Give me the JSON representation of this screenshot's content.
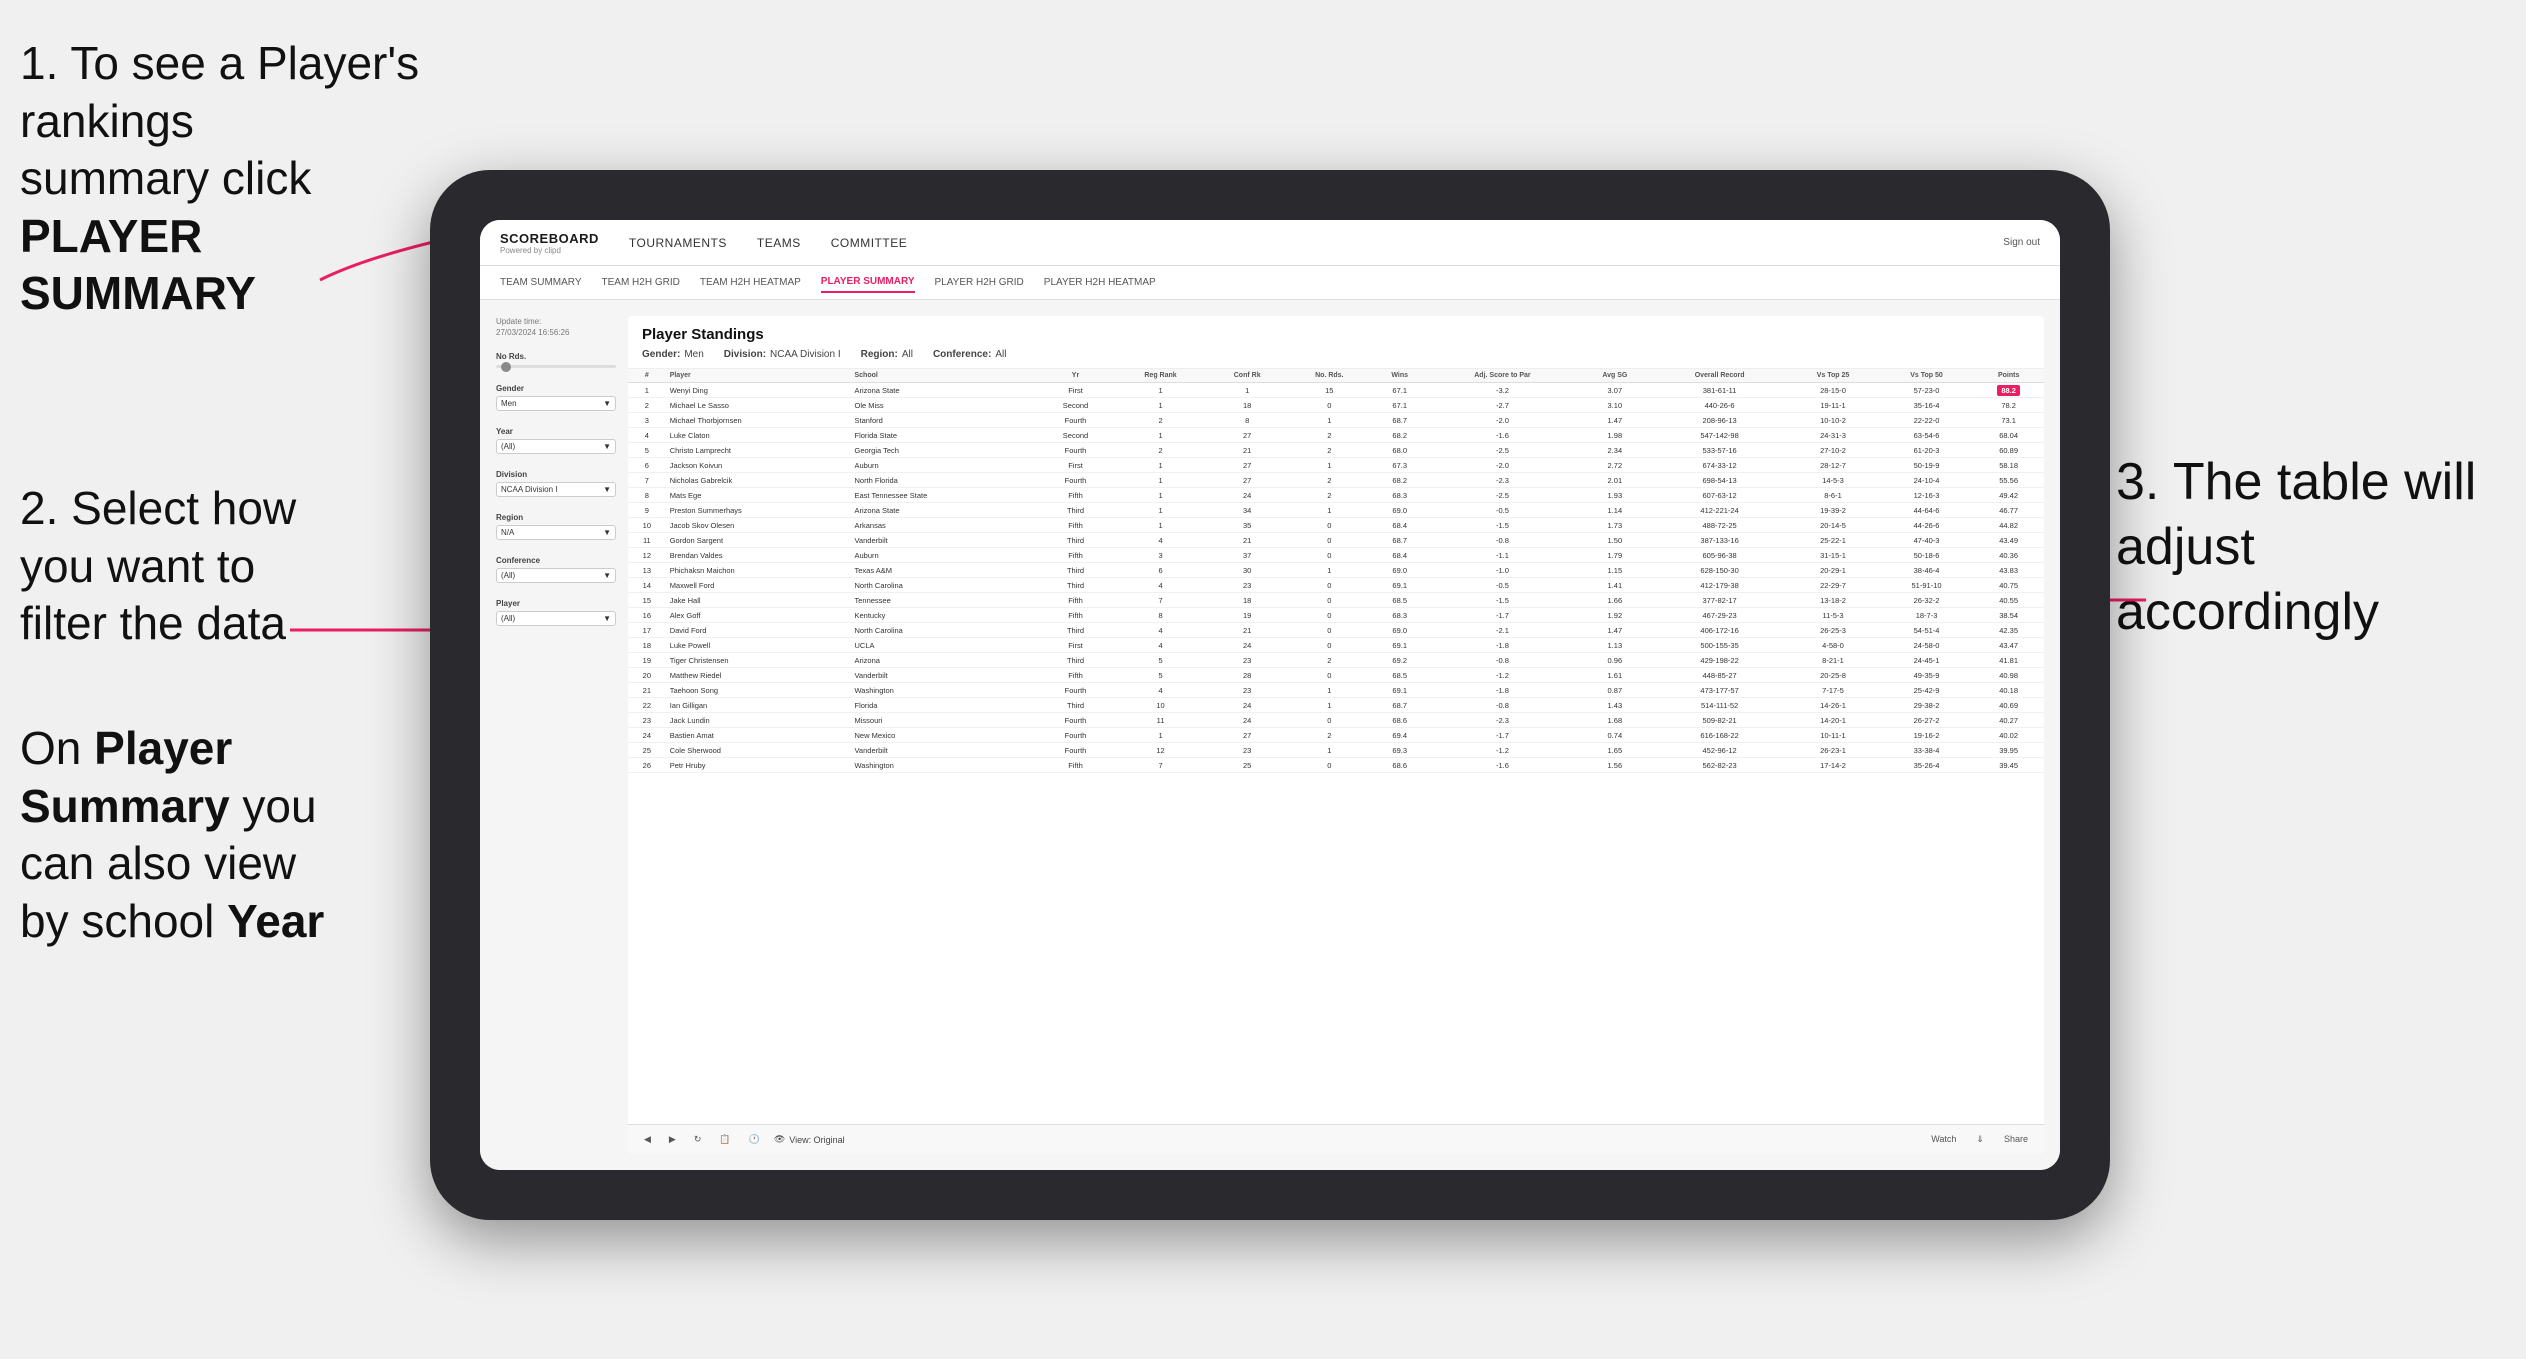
{
  "instructions": {
    "step1_line1": "1. To see a Player's rankings",
    "step1_line2": "summary click ",
    "step1_bold": "PLAYER SUMMARY",
    "step2_line1": "2. Select how",
    "step2_line2": "you want to",
    "step2_line3": "filter the data",
    "step_bottom_line1": "On ",
    "step_bottom_bold1": "Player",
    "step_bottom_line2": "Summary",
    "step_bottom_line3": " you",
    "step_bottom_line4": "can also view",
    "step_bottom_line5": "by school ",
    "step_bottom_bold2": "Year",
    "step3_line1": "3. The table will",
    "step3_line2": "adjust accordingly"
  },
  "nav": {
    "logo": "SCOREBOARD",
    "logo_sub": "Powered by clipd",
    "items": [
      "TOURNAMENTS",
      "TEAMS",
      "COMMITTEE"
    ],
    "sign_out": "Sign out"
  },
  "sub_nav": {
    "items": [
      "TEAM SUMMARY",
      "TEAM H2H GRID",
      "TEAM H2H HEATMAP",
      "PLAYER SUMMARY",
      "PLAYER H2H GRID",
      "PLAYER H2H HEATMAP"
    ]
  },
  "filters": {
    "update_label": "Update time:",
    "update_value": "27/03/2024 16:56:26",
    "no_rds_label": "No Rds.",
    "gender_label": "Gender",
    "gender_value": "Men",
    "year_label": "Year",
    "year_value": "(All)",
    "division_label": "Division",
    "division_value": "NCAA Division I",
    "region_label": "Region",
    "region_value": "N/A",
    "conference_label": "Conference",
    "conference_value": "(All)",
    "player_label": "Player",
    "player_value": "(All)"
  },
  "table": {
    "title": "Player Standings",
    "gender_label": "Gender:",
    "gender_value": "Men",
    "division_label": "Division:",
    "division_value": "NCAA Division I",
    "region_label": "Region:",
    "region_value": "All",
    "conference_label": "Conference:",
    "conference_value": "All",
    "columns": [
      "#",
      "Player",
      "School",
      "Yr",
      "Reg Rank",
      "Conf Rk",
      "No. Rds.",
      "Wins",
      "Adj. Score to Par",
      "Avg SG",
      "Overall Record",
      "Vs Top 25",
      "Vs Top 50",
      "Points"
    ],
    "rows": [
      [
        "1",
        "Wenyi Ding",
        "Arizona State",
        "First",
        "1",
        "1",
        "15",
        "67.1",
        "-3.2",
        "3.07",
        "381-61-11",
        "28-15-0",
        "57-23-0",
        "88.2"
      ],
      [
        "2",
        "Michael Le Sasso",
        "Ole Miss",
        "Second",
        "1",
        "18",
        "0",
        "67.1",
        "-2.7",
        "3.10",
        "440-26-6",
        "19-11-1",
        "35-16-4",
        "78.2"
      ],
      [
        "3",
        "Michael Thorbjornsen",
        "Stanford",
        "Fourth",
        "2",
        "8",
        "1",
        "68.7",
        "-2.0",
        "1.47",
        "208-96-13",
        "10-10-2",
        "22-22-0",
        "73.1"
      ],
      [
        "4",
        "Luke Claton",
        "Florida State",
        "Second",
        "1",
        "27",
        "2",
        "68.2",
        "-1.6",
        "1.98",
        "547-142-98",
        "24-31-3",
        "63-54-6",
        "68.04"
      ],
      [
        "5",
        "Christo Lamprecht",
        "Georgia Tech",
        "Fourth",
        "2",
        "21",
        "2",
        "68.0",
        "-2.5",
        "2.34",
        "533-57-16",
        "27-10-2",
        "61-20-3",
        "60.89"
      ],
      [
        "6",
        "Jackson Koivun",
        "Auburn",
        "First",
        "1",
        "27",
        "1",
        "67.3",
        "-2.0",
        "2.72",
        "674-33-12",
        "28-12-7",
        "50-19-9",
        "58.18"
      ],
      [
        "7",
        "Nicholas Gabrelcik",
        "North Florida",
        "Fourth",
        "1",
        "27",
        "2",
        "68.2",
        "-2.3",
        "2.01",
        "698-54-13",
        "14-5-3",
        "24-10-4",
        "55.56"
      ],
      [
        "8",
        "Mats Ege",
        "East Tennessee State",
        "Fifth",
        "1",
        "24",
        "2",
        "68.3",
        "-2.5",
        "1.93",
        "607-63-12",
        "8-6-1",
        "12-16-3",
        "49.42"
      ],
      [
        "9",
        "Preston Summerhays",
        "Arizona State",
        "Third",
        "1",
        "34",
        "1",
        "69.0",
        "-0.5",
        "1.14",
        "412-221-24",
        "19-39-2",
        "44-64-6",
        "46.77"
      ],
      [
        "10",
        "Jacob Skov Olesen",
        "Arkansas",
        "Fifth",
        "1",
        "35",
        "0",
        "68.4",
        "-1.5",
        "1.73",
        "488-72-25",
        "20-14-5",
        "44-26-6",
        "44.82"
      ],
      [
        "11",
        "Gordon Sargent",
        "Vanderbilt",
        "Third",
        "4",
        "21",
        "0",
        "68.7",
        "-0.8",
        "1.50",
        "387-133-16",
        "25-22-1",
        "47-40-3",
        "43.49"
      ],
      [
        "12",
        "Brendan Valdes",
        "Auburn",
        "Fifth",
        "3",
        "37",
        "0",
        "68.4",
        "-1.1",
        "1.79",
        "605-96-38",
        "31-15-1",
        "50-18-6",
        "40.36"
      ],
      [
        "13",
        "Phichaksn Maichon",
        "Texas A&M",
        "Third",
        "6",
        "30",
        "1",
        "69.0",
        "-1.0",
        "1.15",
        "628-150-30",
        "20-29-1",
        "38-46-4",
        "43.83"
      ],
      [
        "14",
        "Maxwell Ford",
        "North Carolina",
        "Third",
        "4",
        "23",
        "0",
        "69.1",
        "-0.5",
        "1.41",
        "412-179-38",
        "22-29-7",
        "51-91-10",
        "40.75"
      ],
      [
        "15",
        "Jake Hall",
        "Tennessee",
        "Fifth",
        "7",
        "18",
        "0",
        "68.5",
        "-1.5",
        "1.66",
        "377-82-17",
        "13-18-2",
        "26-32-2",
        "40.55"
      ],
      [
        "16",
        "Alex Goff",
        "Kentucky",
        "Fifth",
        "8",
        "19",
        "0",
        "68.3",
        "-1.7",
        "1.92",
        "467-29-23",
        "11-5-3",
        "18-7-3",
        "38.54"
      ],
      [
        "17",
        "David Ford",
        "North Carolina",
        "Third",
        "4",
        "21",
        "0",
        "69.0",
        "-2.1",
        "1.47",
        "406-172-16",
        "26-25-3",
        "54-51-4",
        "42.35"
      ],
      [
        "18",
        "Luke Powell",
        "UCLA",
        "First",
        "4",
        "24",
        "0",
        "69.1",
        "-1.8",
        "1.13",
        "500-155-35",
        "4-58-0",
        "24-58-0",
        "43.47"
      ],
      [
        "19",
        "Tiger Christensen",
        "Arizona",
        "Third",
        "5",
        "23",
        "2",
        "69.2",
        "-0.8",
        "0.96",
        "429-198-22",
        "8-21-1",
        "24-45-1",
        "41.81"
      ],
      [
        "20",
        "Matthew Riedel",
        "Vanderbilt",
        "Fifth",
        "5",
        "28",
        "0",
        "68.5",
        "-1.2",
        "1.61",
        "448-85-27",
        "20-25-8",
        "49-35-9",
        "40.98"
      ],
      [
        "21",
        "Taehoon Song",
        "Washington",
        "Fourth",
        "4",
        "23",
        "1",
        "69.1",
        "-1.8",
        "0.87",
        "473-177-57",
        "7-17-5",
        "25-42-9",
        "40.18"
      ],
      [
        "22",
        "Ian Gilligan",
        "Florida",
        "Third",
        "10",
        "24",
        "1",
        "68.7",
        "-0.8",
        "1.43",
        "514-111-52",
        "14-26-1",
        "29-38-2",
        "40.69"
      ],
      [
        "23",
        "Jack Lundin",
        "Missouri",
        "Fourth",
        "11",
        "24",
        "0",
        "68.6",
        "-2.3",
        "1.68",
        "509-82-21",
        "14-20-1",
        "26-27-2",
        "40.27"
      ],
      [
        "24",
        "Bastien Amat",
        "New Mexico",
        "Fourth",
        "1",
        "27",
        "2",
        "69.4",
        "-1.7",
        "0.74",
        "616-168-22",
        "10-11-1",
        "19-16-2",
        "40.02"
      ],
      [
        "25",
        "Cole Sherwood",
        "Vanderbilt",
        "Fourth",
        "12",
        "23",
        "1",
        "69.3",
        "-1.2",
        "1.65",
        "452-96-12",
        "26-23-1",
        "33-38-4",
        "39.95"
      ],
      [
        "26",
        "Petr Hruby",
        "Washington",
        "Fifth",
        "7",
        "25",
        "0",
        "68.6",
        "-1.6",
        "1.56",
        "562-82-23",
        "17-14-2",
        "35-26-4",
        "39.45"
      ]
    ]
  },
  "toolbar": {
    "view_label": "View: Original",
    "watch_label": "Watch",
    "share_label": "Share"
  }
}
